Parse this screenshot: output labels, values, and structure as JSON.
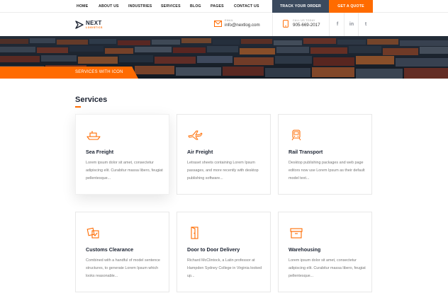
{
  "nav": {
    "items": [
      "HOME",
      "ABOUT US",
      "INDUSTRIES",
      "SERVICES",
      "BLOG",
      "PAGES",
      "CONTACT US"
    ],
    "track_label": "TRACK YOUR ORDER",
    "quote_label": "GET A QUOTE"
  },
  "header": {
    "logo_brand": "NEXT",
    "logo_sub": "LOGISTICS",
    "email_label": "EMAIL",
    "email_value": "info@nextlog.com",
    "phone_label": "CALL US TODAY",
    "phone_value": "905-669-2017",
    "social": [
      "f",
      "in",
      "t"
    ]
  },
  "hero": {
    "label": "SERVICES WITH ICON"
  },
  "services": {
    "title": "Services",
    "cards": [
      {
        "icon": "ship-icon",
        "title": "Sea Freight",
        "text": "Lorem ipsum dolor sit amet, consectetur adipiscing elit. Curabitur massa libero, feugiat pellentesque..."
      },
      {
        "icon": "plane-icon",
        "title": "Air Freight",
        "text": "Letraset sheets containing Lorem Ipsum passages, and more recently with desktop publishing software..."
      },
      {
        "icon": "train-icon",
        "title": "Rail Transport",
        "text": "Desktop publishing packages and web page editors now use Lorem Ipsum as their default model text..."
      },
      {
        "icon": "customs-icon",
        "title": "Customs Clearance",
        "text": "Combined with a handful of model sentence structures, to generate Lorem Ipsum which looks reasonable..."
      },
      {
        "icon": "door-icon",
        "title": "Door to Door Delivery",
        "text": "Richard McClintock, a Latin professor at Hampden Sydney College in Virginia looked up..."
      },
      {
        "icon": "warehouse-icon",
        "title": "Warehousing",
        "text": "Lorem ipsum dolor sit amet, consectetur adipiscing elit. Curabitur massa libero, feugiat pellentesque..."
      }
    ]
  },
  "colors": {
    "accent": "#ff6b00",
    "navy": "#3b4a5e",
    "heading": "#1d2433"
  }
}
